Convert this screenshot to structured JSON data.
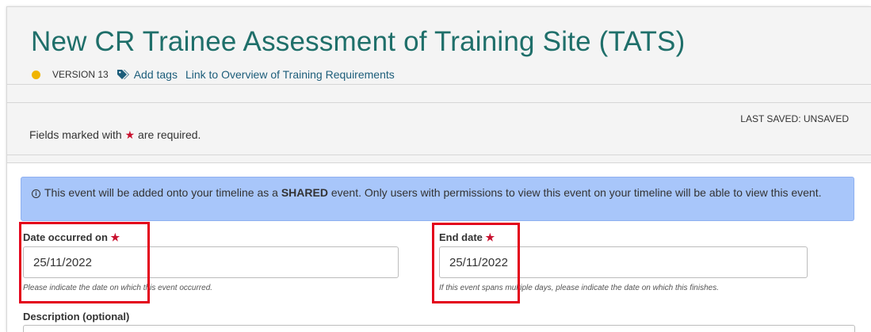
{
  "header": {
    "title": "New CR Trainee Assessment of Training Site (TATS)",
    "version": "VERSION 13",
    "add_tags": "Add tags",
    "overview_link": "Link to Overview of Training Requirements",
    "status_color": "#f0b400"
  },
  "status": {
    "required_prefix": "Fields marked with",
    "required_star": "★",
    "required_suffix": "are required.",
    "last_saved": "LAST SAVED: UNSAVED"
  },
  "info": {
    "icon": "info-circle-icon",
    "text_before": "This event will be added onto your timeline as a",
    "text_strong": "SHARED",
    "text_after": "event. Only users with permissions to view this event on your timeline will be able to view this event."
  },
  "fields": {
    "date_occurred": {
      "label": "Date occurred on",
      "star": "★",
      "value": "25/11/2022",
      "help": "Please indicate the date on which this event occurred."
    },
    "end_date": {
      "label": "End date",
      "star": "★",
      "value": "25/11/2022",
      "help": "If this event spans multiple days, please indicate the date on which this finishes."
    },
    "description": {
      "label": "Description (optional)"
    }
  },
  "colors": {
    "title": "#1f6f6a",
    "link": "#1c5d7a",
    "required_star": "#c8102e",
    "info_background": "#a8c6fa",
    "highlight": "#e3001b"
  }
}
